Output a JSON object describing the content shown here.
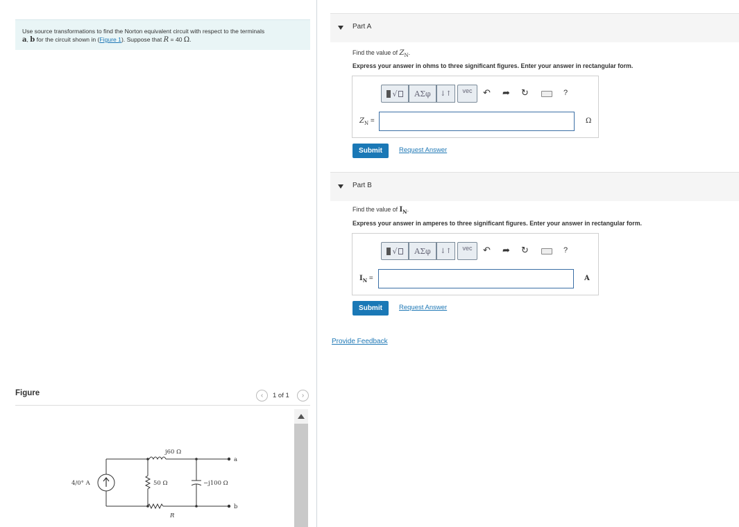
{
  "problem": {
    "text_1": "Use source transformations to find the Norton equivalent circuit with respect to the terminals",
    "terminal_a": "a",
    "text_2": ", ",
    "terminal_b": "b",
    "text_3": " for the circuit shown in (",
    "figure_link": "Figure 1",
    "text_4": "). Suppose that ",
    "var_r": "R",
    "text_5": " = 40 ",
    "unit_ohm": "Ω",
    "text_6": "."
  },
  "figure": {
    "title": "Figure",
    "pager_label": "1 of 1",
    "prev_icon": "chevron-left-icon",
    "next_icon": "chevron-right-icon",
    "circuit": {
      "source_label": "4/0° A",
      "inductor_label": "j60 Ω",
      "resistor_50_label": "50 Ω",
      "capacitor_label": "−j100 Ω",
      "resistor_r_label": "R",
      "terminal_a": "a",
      "terminal_b": "b"
    }
  },
  "partA": {
    "title": "Part A",
    "question_prefix": "Find the value of ",
    "question_var": "Z",
    "question_sub": "N",
    "question_suffix": ".",
    "instructions": "Express your answer in ohms to three significant figures. Enter your answer in rectangular form.",
    "var_label": "Z",
    "var_sub": "N",
    "var_eq": " =",
    "input_value": "",
    "unit": "Ω",
    "submit_label": "Submit",
    "request_label": "Request Answer"
  },
  "partB": {
    "title": "Part B",
    "question_prefix": "Find the value of ",
    "question_var": "I",
    "question_sub": "N",
    "question_suffix": ".",
    "instructions": "Express your answer in amperes to three significant figures. Enter your answer in rectangular form.",
    "var_label": "I",
    "var_sub": "N",
    "var_eq": " =",
    "input_value": "",
    "unit": "A",
    "submit_label": "Submit",
    "request_label": "Request Answer"
  },
  "toolbar": {
    "greek_label": "ΑΣφ",
    "arrows_label": "↓↑",
    "vec_label": "vec",
    "undo_icon": "undo-icon",
    "redo_icon": "redo-icon",
    "reset_icon": "reset-icon",
    "keyboard_icon": "keyboard-icon",
    "help_label": "?"
  },
  "feedback_label": "Provide Feedback",
  "colors": {
    "accent": "#1a78b6",
    "link": "#1d77b5",
    "problem_bg": "#e9f5f6",
    "part_header_bg": "#f5f5f5"
  }
}
